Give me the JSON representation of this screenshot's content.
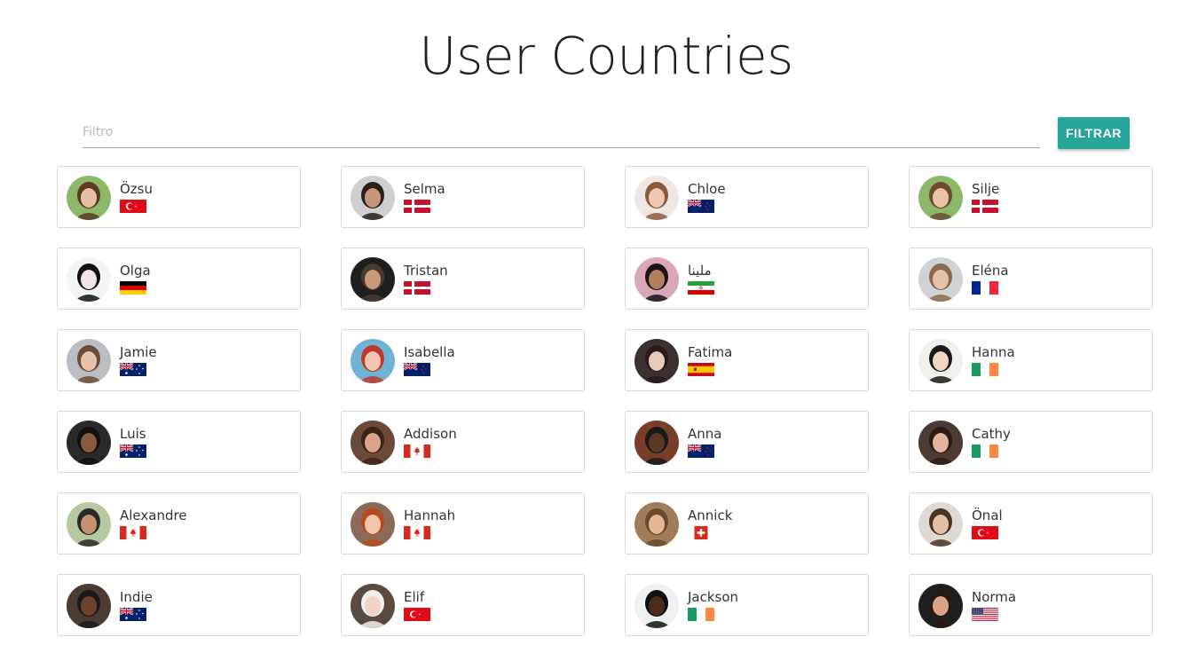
{
  "page": {
    "title": "User Countries"
  },
  "filter": {
    "placeholder": "Filtro",
    "value": "",
    "button_label": "FILTRAR",
    "accent_color": "#26a69a"
  },
  "users": [
    {
      "name": "Özsu",
      "flag": "tr-flag-icon",
      "avatar": "avatar-photo-icon"
    },
    {
      "name": "Selma",
      "flag": "dk-flag-icon",
      "avatar": "avatar-photo-icon"
    },
    {
      "name": "Chloe",
      "flag": "nz-flag-icon",
      "avatar": "avatar-photo-icon"
    },
    {
      "name": "Silje",
      "flag": "dk-flag-icon",
      "avatar": "avatar-photo-icon"
    },
    {
      "name": "Olga",
      "flag": "de-flag-icon",
      "avatar": "avatar-photo-icon"
    },
    {
      "name": "Tristan",
      "flag": "dk-flag-icon",
      "avatar": "avatar-photo-icon"
    },
    {
      "name": "ملينا",
      "flag": "ir-flag-icon",
      "avatar": "avatar-photo-icon"
    },
    {
      "name": "Eléna",
      "flag": "fr-flag-icon",
      "avatar": "avatar-photo-icon"
    },
    {
      "name": "Jamie",
      "flag": "au-flag-icon",
      "avatar": "avatar-photo-icon"
    },
    {
      "name": "Isabella",
      "flag": "nz-flag-icon",
      "avatar": "avatar-photo-icon"
    },
    {
      "name": "Fatima",
      "flag": "es-flag-icon",
      "avatar": "avatar-photo-icon"
    },
    {
      "name": "Hanna",
      "flag": "ie-flag-icon",
      "avatar": "avatar-photo-icon"
    },
    {
      "name": "Luis",
      "flag": "au-flag-icon",
      "avatar": "avatar-photo-icon"
    },
    {
      "name": "Addison",
      "flag": "ca-flag-icon",
      "avatar": "avatar-photo-icon"
    },
    {
      "name": "Anna",
      "flag": "nz-flag-icon",
      "avatar": "avatar-photo-icon"
    },
    {
      "name": "Cathy",
      "flag": "ie-flag-icon",
      "avatar": "avatar-photo-icon"
    },
    {
      "name": "Alexandre",
      "flag": "ca-flag-icon",
      "avatar": "avatar-photo-icon"
    },
    {
      "name": "Hannah",
      "flag": "ca-flag-icon",
      "avatar": "avatar-photo-icon"
    },
    {
      "name": "Annick",
      "flag": "ch-flag-icon",
      "avatar": "avatar-photo-icon"
    },
    {
      "name": "Önal",
      "flag": "tr-flag-icon",
      "avatar": "avatar-photo-icon"
    },
    {
      "name": "Indie",
      "flag": "au-flag-icon",
      "avatar": "avatar-photo-icon"
    },
    {
      "name": "Elif",
      "flag": "tr-flag-icon",
      "avatar": "avatar-photo-icon"
    },
    {
      "name": "Jackson",
      "flag": "ie-flag-icon",
      "avatar": "avatar-photo-icon"
    },
    {
      "name": "Norma",
      "flag": "us-flag-icon",
      "avatar": "avatar-photo-icon"
    }
  ]
}
